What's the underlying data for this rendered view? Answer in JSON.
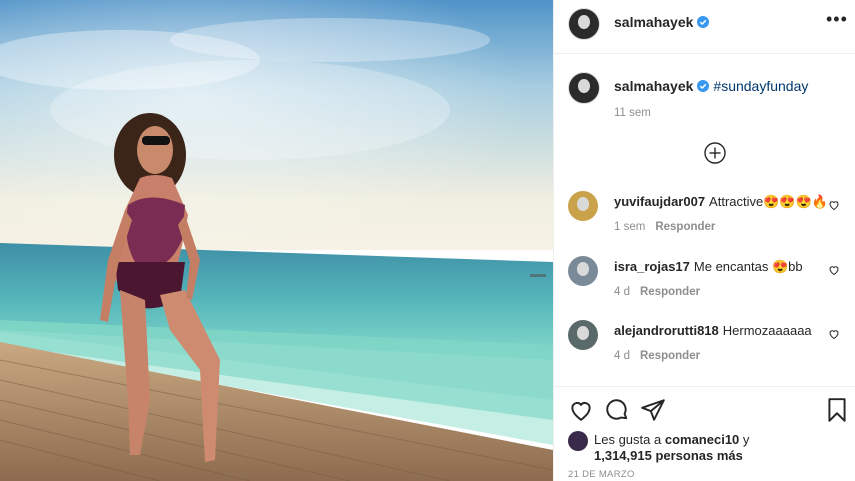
{
  "post": {
    "username": "salmahayek",
    "verified": true,
    "more_icon": "more-options-icon"
  },
  "caption": {
    "username": "salmahayek",
    "hashtag": "#sundayfunday",
    "time": "11 sem"
  },
  "load_more_icon": "plus-circle-icon",
  "comments": [
    {
      "username": "yuvifaujdar007",
      "text": "Attractive😍😍😍🔥",
      "time": "1 sem",
      "reply": "Responder",
      "avatar_color": "#c9a24a"
    },
    {
      "username": "isra_rojas17",
      "text": "Me encantas 😍bb",
      "time": "4 d",
      "reply": "Responder",
      "avatar_color": "#7a8a99"
    },
    {
      "username": "alejandrorutti818",
      "text": "Hermozaaaaaa",
      "time": "4 d",
      "reply": "Responder",
      "avatar_color": "#5a6a6a"
    }
  ],
  "actions": {
    "like_icon": "heart-icon",
    "comment_icon": "comment-icon",
    "share_icon": "send-icon",
    "save_icon": "bookmark-icon"
  },
  "likes": {
    "line1_prefix": "Les gusta a",
    "liker": "comaneci10",
    "line1_suffix": "y",
    "count_text": "1,314,915 personas más"
  },
  "date": "21 DE MARZO",
  "colors": {
    "accent_link": "#00376b",
    "verified_blue": "#3897f0",
    "muted_text": "#8e8e8e"
  }
}
